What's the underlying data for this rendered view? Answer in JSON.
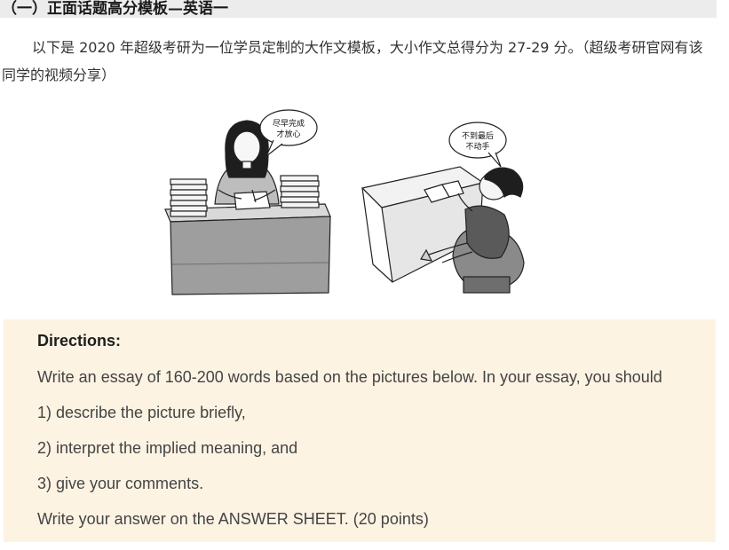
{
  "heading": "（一）正面话题高分模板—英语一",
  "intro": "以下是 2020 年超级考研为一位学员定制的大作文模板，大小作文总得分为 27-29 分。（超级考研官网有该同学的视频分享）",
  "cartoon": {
    "bubble_left": [
      "尽早完成",
      "才放心"
    ],
    "bubble_right": [
      "不到最后",
      "不动手"
    ]
  },
  "directions": {
    "title": "Directions:",
    "lines": [
      "Write an essay of 160-200 words based on the pictures below. In your essay, you should",
      "1) describe the picture briefly,",
      "2) interpret the implied meaning, and",
      "3) give your comments.",
      "Write your answer on the ANSWER SHEET. (20 points)"
    ]
  },
  "colors": {
    "heading_bg": "#ececec",
    "directions_bg": "#fdf3e3",
    "text": "#333333"
  }
}
